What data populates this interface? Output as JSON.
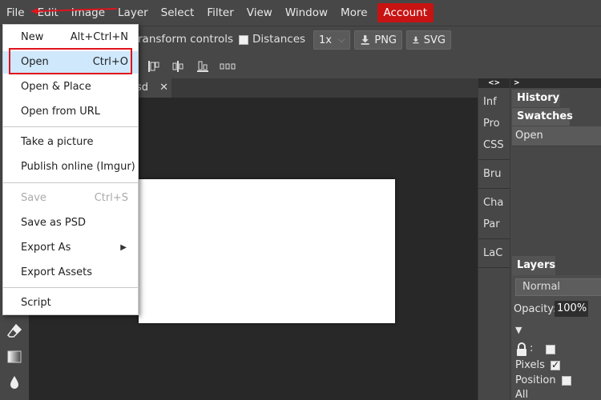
{
  "menubar": {
    "items": [
      "File",
      "Edit",
      "Image",
      "Layer",
      "Select",
      "Filter",
      "View",
      "Window",
      "More"
    ],
    "account": "Account"
  },
  "options": {
    "transform_label": "ransform controls",
    "distances_label": "Distances",
    "zoom_value": "1x",
    "png_label": "PNG",
    "svg_label": "SVG"
  },
  "document": {
    "tab_name": "sd"
  },
  "narrow_panel": {
    "header": "<>",
    "groups": [
      [
        "Inf",
        "Pro",
        "CSS"
      ],
      [
        "Bru"
      ],
      [
        "Cha",
        "Par"
      ],
      [
        "LaC"
      ]
    ]
  },
  "right_panel": {
    "header": ">",
    "history_tab": "History",
    "swatches_tab": "Swatches",
    "history_entry": "Open",
    "layers_tab": "Layers",
    "blend_mode": "Normal",
    "opacity_label": "Opacity:",
    "opacity_value": "100%",
    "lock_colon": ":",
    "pixels_label": "Pixels",
    "position_label": "Position",
    "all_label": "All"
  },
  "file_menu": {
    "items": [
      {
        "label": "New",
        "shortcut": "Alt+Ctrl+N"
      },
      {
        "label": "Open",
        "shortcut": "Ctrl+O"
      },
      {
        "label": "Open & Place",
        "shortcut": ""
      },
      {
        "label": "Open from URL",
        "shortcut": ""
      },
      {
        "label": "Take a picture",
        "shortcut": ""
      },
      {
        "label": "Publish online (Imgur)",
        "shortcut": ""
      },
      {
        "label": "Save",
        "shortcut": "Ctrl+S"
      },
      {
        "label": "Save as PSD",
        "shortcut": ""
      },
      {
        "label": "Export As",
        "shortcut": ""
      },
      {
        "label": "Export Assets",
        "shortcut": ""
      },
      {
        "label": "Script",
        "shortcut": ""
      }
    ]
  },
  "colors": {
    "accent": "#c81313",
    "highlight_box": "#e0141e",
    "menu_hover": "#cfe8fc"
  }
}
